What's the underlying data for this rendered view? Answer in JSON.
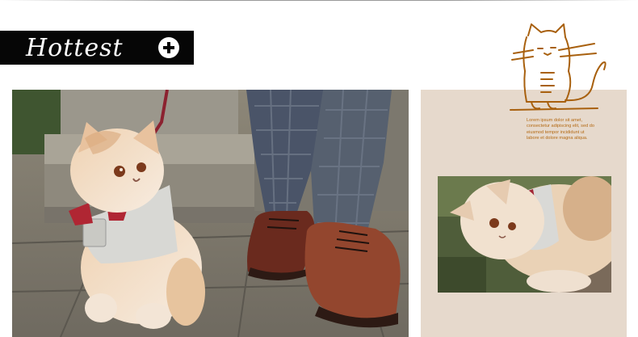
{
  "banner": {
    "title": "Hottest",
    "action_icon": "plus-circle-icon"
  },
  "side_panel": {
    "caption": "Lorem ipsum dolor sit amet, consectetur adipiscing elit, sed do eiusmod tempor incididunt ut labore et dolore magna aliqua."
  },
  "colors": {
    "banner_background": "#060606",
    "banner_text": "#ffffff",
    "panel_background": "#e6d9cc",
    "caption_text": "#b46a14",
    "doodle_stroke": "#a8600e"
  }
}
